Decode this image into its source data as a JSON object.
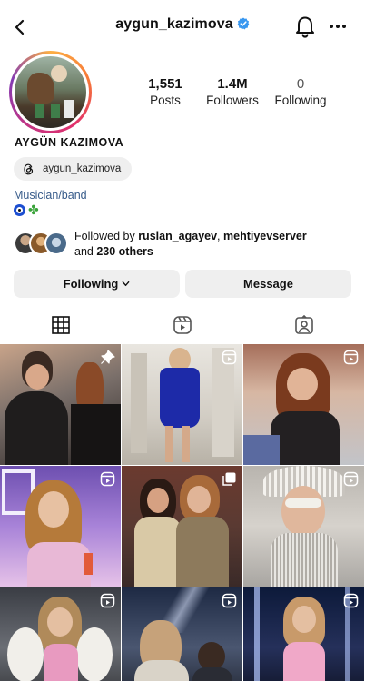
{
  "header": {
    "username": "aygun_kazimova",
    "verified": true
  },
  "profile": {
    "display_name": "AYGÜN KAZIMOVA",
    "stats": [
      {
        "value": "1,551",
        "label": "Posts"
      },
      {
        "value": "1.4M",
        "label": "Followers"
      },
      {
        "value": "0",
        "label": "Following"
      }
    ],
    "threads_handle": "aygun_kazimova",
    "category": "Musician/band",
    "bio_emojis": [
      "nazar-amulet",
      "four-leaf-clover"
    ],
    "followed_by": {
      "prefix": "Followed by",
      "user1": "ruslan_agayev",
      "separator": ",",
      "user2": "mehtiyevserver",
      "joiner": "and",
      "others": "230 others"
    }
  },
  "actions": {
    "following_label": "Following",
    "message_label": "Message"
  },
  "tabs": [
    {
      "icon": "grid-icon",
      "active": true
    },
    {
      "icon": "reels-icon",
      "active": false
    },
    {
      "icon": "tagged-icon",
      "active": false
    }
  ],
  "posts": [
    {
      "badge": "pinned"
    },
    {
      "badge": "reel"
    },
    {
      "badge": "reel"
    },
    {
      "badge": "reel"
    },
    {
      "badge": "carousel"
    },
    {
      "badge": "reel"
    },
    {
      "badge": "reel"
    },
    {
      "badge": "reel"
    },
    {
      "badge": "reel"
    }
  ],
  "colors": {
    "accent_link": "#375b8a",
    "button_bg": "#efefef",
    "verified": "#3897f0"
  }
}
